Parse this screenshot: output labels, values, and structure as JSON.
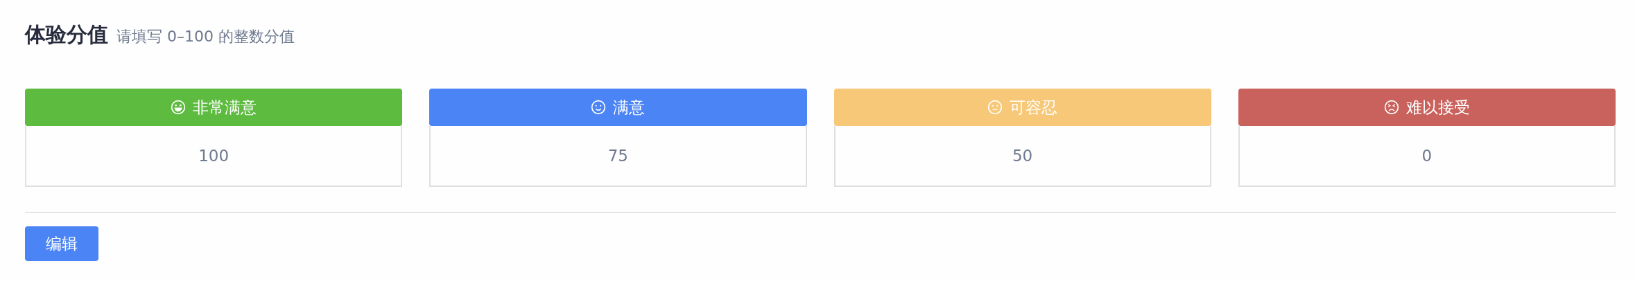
{
  "header": {
    "title": "体验分值",
    "hint": "请填写 0–100 的整数分值"
  },
  "levels": [
    {
      "kind": "grin",
      "label": "非常满意",
      "color": "#5dbb3f",
      "score": "100"
    },
    {
      "kind": "smile",
      "label": "满意",
      "color": "#4b84f5",
      "score": "75"
    },
    {
      "kind": "neutral",
      "label": "可容忍",
      "color": "#f6c878",
      "score": "50"
    },
    {
      "kind": "sad",
      "label": "难以接受",
      "color": "#c9625c",
      "score": "0"
    }
  ],
  "edit_button": "编辑"
}
